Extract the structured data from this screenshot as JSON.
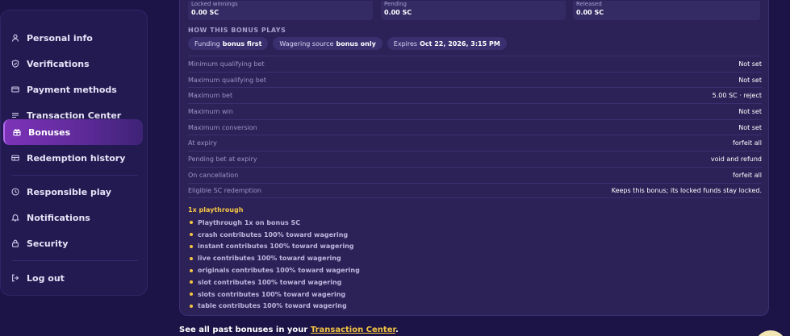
{
  "sidebar": {
    "items": [
      {
        "label": "Personal info",
        "icon": "user-icon"
      },
      {
        "label": "Verifications",
        "icon": "shield-check-icon"
      },
      {
        "label": "Payment methods",
        "icon": "credit-card-icon"
      },
      {
        "label": "Transaction Center",
        "icon": "list-icon"
      },
      {
        "label": "Bonuses",
        "icon": "gift-icon",
        "active": true
      },
      {
        "label": "Redemption history",
        "icon": "receipt-icon"
      },
      {
        "label": "Responsible play",
        "icon": "clock-icon"
      },
      {
        "label": "Notifications",
        "icon": "bell-icon"
      },
      {
        "label": "Security",
        "icon": "lock-icon"
      },
      {
        "label": "Log out",
        "icon": "logout-icon"
      }
    ]
  },
  "bonus": {
    "stats": [
      {
        "label": "Locked winnings",
        "value": "0.00 SC"
      },
      {
        "label": "Pending",
        "value": "0.00 SC"
      },
      {
        "label": "Released",
        "value": "0.00 SC"
      }
    ],
    "how_title": "HOW THIS BONUS PLAYS",
    "chips": [
      {
        "key": "Funding",
        "value": "bonus first"
      },
      {
        "key": "Wagering source",
        "value": "bonus only"
      },
      {
        "key": "Expires",
        "value": "Oct 22, 2026, 3:15 PM"
      }
    ],
    "rules": [
      {
        "label": "Minimum qualifying bet",
        "value": "Not set"
      },
      {
        "label": "Maximum qualifying bet",
        "value": "Not set"
      },
      {
        "label": "Maximum bet",
        "value": "5.00 SC · reject"
      },
      {
        "label": "Maximum win",
        "value": "Not set"
      },
      {
        "label": "Maximum conversion",
        "value": "Not set"
      },
      {
        "label": "At expiry",
        "value": "forfeit all"
      },
      {
        "label": "Pending bet at expiry",
        "value": "void and refund"
      },
      {
        "label": "On cancellation",
        "value": "forfeit all"
      },
      {
        "label": "Eligible SC redemption",
        "value": "Keeps this bonus; its locked funds stay locked."
      }
    ],
    "playthrough_title": "1x playthrough",
    "playthrough_items": [
      "Playthrough 1x on bonus SC",
      "crash contributes 100% toward wagering",
      "instant contributes 100% toward wagering",
      "live contributes 100% toward wagering",
      "originals contributes 100% toward wagering",
      "slot contributes 100% toward wagering",
      "slots contributes 100% toward wagering",
      "table contributes 100% toward wagering"
    ]
  },
  "footer": {
    "text": "See all past bonuses in your",
    "link": "Transaction Center",
    "end": "."
  },
  "colors": {
    "background": "#1c1446",
    "card": "#2c2258",
    "accent_gold": "#f5c542",
    "active_purple": "#7d33b8"
  }
}
